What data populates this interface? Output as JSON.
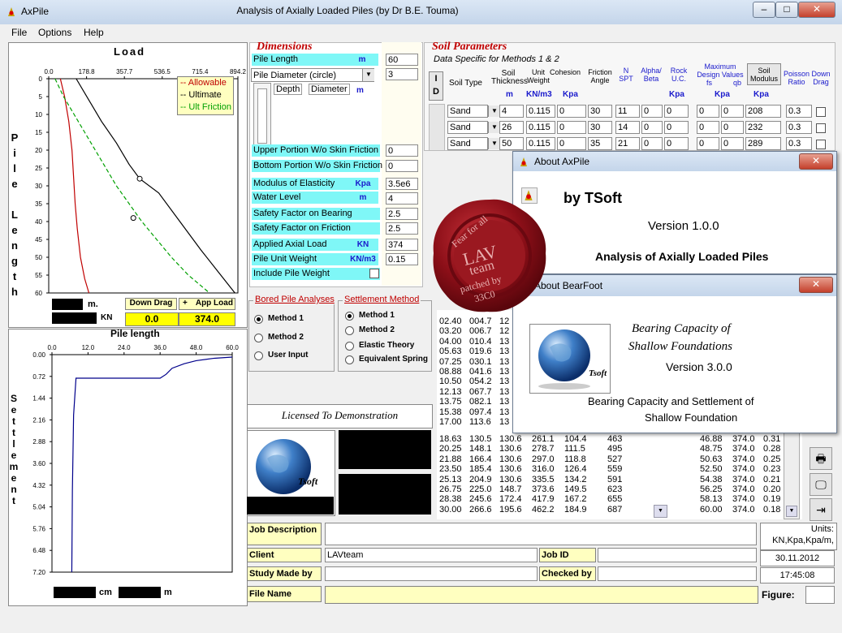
{
  "window": {
    "app_name": "AxPile",
    "title": "Analysis of Axially Loaded Piles (by Dr B.E. Touma)",
    "min": "–",
    "max": "□",
    "close": "✕"
  },
  "menu": [
    "File",
    "Options",
    "Help"
  ],
  "load_chart": {
    "title": "Load",
    "y_label": "Pile Length",
    "x_ticks": [
      "0.0",
      "178.8",
      "357.7",
      "536.5",
      "715.4",
      "894.2"
    ],
    "y_ticks": [
      "0",
      "5",
      "10",
      "15",
      "20",
      "25",
      "30",
      "35",
      "40",
      "45",
      "50",
      "55",
      "60"
    ],
    "legend": [
      "Allowable",
      "Ultimate",
      "Ult Friction"
    ],
    "unit_m": "m.",
    "unit_kn": "KN",
    "down_drag_label": "Down Drag",
    "app_load_label": "App Load",
    "plus": "+",
    "down_drag_value": "0.0",
    "app_load_value": "374.0"
  },
  "chart_data": [
    {
      "type": "line",
      "title": "Load",
      "ylabel": "Pile Length",
      "xlim": [
        0,
        894.2
      ],
      "ylim": [
        0,
        60
      ],
      "series": [
        {
          "name": "Allowable",
          "color": "#c00000",
          "points": [
            [
              55,
              0
            ],
            [
              75,
              5
            ],
            [
              95,
              12
            ],
            [
              110,
              20
            ],
            [
              118,
              28
            ],
            [
              125,
              35
            ],
            [
              135,
              42
            ],
            [
              150,
              50
            ],
            [
              170,
              56
            ],
            [
              190,
              60
            ]
          ]
        },
        {
          "name": "Ultimate",
          "color": "#000000",
          "points": [
            [
              130,
              0
            ],
            [
              190,
              6
            ],
            [
              250,
              12
            ],
            [
              320,
              18
            ],
            [
              380,
              24
            ],
            [
              430,
              28
            ],
            [
              520,
              32
            ],
            [
              620,
              40
            ],
            [
              720,
              48
            ],
            [
              800,
              54
            ],
            [
              880,
              60
            ]
          ]
        },
        {
          "name": "Ult Friction",
          "color": "#00a000",
          "points": [
            [
              30,
              0
            ],
            [
              70,
              5
            ],
            [
              120,
              10
            ],
            [
              170,
              15
            ],
            [
              220,
              20
            ],
            [
              270,
              25
            ],
            [
              320,
              30
            ],
            [
              380,
              35
            ],
            [
              440,
              40
            ],
            [
              510,
              45
            ],
            [
              580,
              50
            ],
            [
              660,
              55
            ],
            [
              760,
              60
            ]
          ]
        }
      ],
      "markers": [
        [
          430,
          28
        ],
        [
          400,
          39
        ]
      ]
    },
    {
      "type": "line",
      "title": "Pile length",
      "ylabel": "Settlement",
      "xlim": [
        0,
        60
      ],
      "ylim": [
        0,
        7.2
      ],
      "series": [
        {
          "name": "",
          "color": "#00008b",
          "points": [
            [
              6.6,
              7.2
            ],
            [
              6.8,
              4.5
            ],
            [
              7.2,
              2.0
            ],
            [
              8.0,
              0.78
            ],
            [
              12,
              0.78
            ],
            [
              24,
              0.78
            ],
            [
              36,
              0.78
            ],
            [
              38,
              0.65
            ],
            [
              40,
              0.45
            ],
            [
              44,
              0.3
            ],
            [
              48,
              0.2
            ],
            [
              54,
              0.12
            ],
            [
              60,
              0.08
            ]
          ]
        }
      ]
    }
  ],
  "settlement_chart": {
    "title": "Pile length",
    "y_label": "Settlement",
    "x_ticks": [
      "0.0",
      "12.0",
      "24.0",
      "36.0",
      "48.0",
      "60.0"
    ],
    "y_ticks": [
      "0.00",
      "0.72",
      "1.44",
      "2.16",
      "2.88",
      "3.60",
      "4.32",
      "5.04",
      "5.76",
      "6.48",
      "7.20"
    ],
    "unit_cm": "cm",
    "unit_m": "m"
  },
  "dimensions": {
    "title": "Dimensions",
    "pile_length": {
      "label": "Pile Length",
      "unit": "m",
      "value": "60"
    },
    "pile_diameter": {
      "label": "Pile Diameter (circle)",
      "value": "3"
    },
    "depth_col": "Depth",
    "diameter_col": "Diameter",
    "diameter_unit": "m",
    "upper_portion": {
      "label": "Upper Portion W/o Skin Friction",
      "value": "0"
    },
    "bottom_portion": {
      "label": "Bottom Portion W/o Skin Friction",
      "value": "0"
    },
    "modulus": {
      "label": "Modulus of Elasticity",
      "unit": "Kpa",
      "value": "3.5e6"
    },
    "water_level": {
      "label": "Water Level",
      "unit": "m",
      "value": "4"
    },
    "sf_bearing": {
      "label": "Safety Factor on Bearing",
      "value": "2.5"
    },
    "sf_friction": {
      "label": "Safety Factor on Friction",
      "value": "2.5"
    },
    "axial_load": {
      "label": "Applied Axial Load",
      "unit": "KN",
      "value": "374"
    },
    "unit_weight": {
      "label": "Pile Unit Weight",
      "unit": "KN/m3",
      "value": "0.15"
    },
    "include_weight": {
      "label": "Include Pile Weight"
    }
  },
  "bored": {
    "title": "Bored Pile Analyses",
    "options": [
      "Method 1",
      "Method 2",
      "User Input"
    ],
    "selected": 0
  },
  "settlement_method": {
    "title": "Settlement Method",
    "options": [
      "Method 1",
      "Method 2",
      "Elastic Theory",
      "Equivalent Spring"
    ],
    "selected": 0
  },
  "license": "Licensed To Demonstration",
  "logo_text": "Tsoft",
  "soil": {
    "title": "Soil Parameters",
    "subtitle": "Data Specific for Methods 1 & 2",
    "id_btn": [
      "I",
      "D"
    ],
    "headers": {
      "soil_type": "Soil Type",
      "soil_thickness": "Soil Thickness",
      "unit_weight": "Unit Weight",
      "cohesion": "Cohesion",
      "friction_angle": "Friction Angle",
      "n_spt": "N SPT",
      "alpha_beta": "Alpha/ Beta",
      "rock_uc": "Rock U.C.",
      "max_design": "Maximum Design Values",
      "fs": "fs",
      "qb": "qb",
      "soil_modulus": "Soil Modulus",
      "poisson": "Poisson Ratio",
      "down_drag": "Down Drag"
    },
    "units": {
      "m": "m",
      "knm3": "KN/m3",
      "kpa1": "Kpa",
      "kpa2": "Kpa",
      "kpa3": "Kpa",
      "kpa4": "Kpa"
    },
    "rows": [
      [
        "Sand",
        "4",
        "0.115",
        "0",
        "30",
        "11",
        "0",
        "0",
        "0",
        "0",
        "208",
        "0.3"
      ],
      [
        "Sand",
        "26",
        "0.115",
        "0",
        "30",
        "14",
        "0",
        "0",
        "0",
        "0",
        "232",
        "0.3"
      ],
      [
        "Sand",
        "50",
        "0.115",
        "0",
        "35",
        "21",
        "0",
        "0",
        "0",
        "0",
        "289",
        "0.3"
      ]
    ]
  },
  "results_left": [
    [
      "02.40",
      "004.7",
      "12"
    ],
    [
      "03.20",
      "006.7",
      "12"
    ],
    [
      "04.00",
      "010.4",
      "13"
    ],
    [
      "05.63",
      "019.6",
      "13"
    ],
    [
      "07.25",
      "030.1",
      "13"
    ],
    [
      "08.88",
      "041.6",
      "13"
    ],
    [
      "10.50",
      "054.2",
      "13"
    ],
    [
      "12.13",
      "067.7",
      "13"
    ],
    [
      "13.75",
      "082.1",
      "13"
    ],
    [
      "15.38",
      "097.4",
      "13"
    ],
    [
      "17.00",
      "113.6",
      "13"
    ]
  ],
  "results_full": [
    [
      "18.63",
      "130.5",
      "130.6",
      "261.1",
      "104.4",
      "463",
      "46.88",
      "374.0",
      "0.31"
    ],
    [
      "20.25",
      "148.1",
      "130.6",
      "278.7",
      "111.5",
      "495",
      "48.75",
      "374.0",
      "0.28"
    ],
    [
      "21.88",
      "166.4",
      "130.6",
      "297.0",
      "118.8",
      "527",
      "50.63",
      "374.0",
      "0.25"
    ],
    [
      "23.50",
      "185.4",
      "130.6",
      "316.0",
      "126.4",
      "559",
      "52.50",
      "374.0",
      "0.23"
    ],
    [
      "25.13",
      "204.9",
      "130.6",
      "335.5",
      "134.2",
      "591",
      "54.38",
      "374.0",
      "0.21"
    ],
    [
      "26.75",
      "225.0",
      "148.7",
      "373.6",
      "149.5",
      "623",
      "56.25",
      "374.0",
      "0.20"
    ],
    [
      "28.38",
      "245.6",
      "172.4",
      "417.9",
      "167.2",
      "655",
      "58.13",
      "374.0",
      "0.19"
    ],
    [
      "30.00",
      "266.6",
      "195.6",
      "462.2",
      "184.9",
      "687",
      "60.00",
      "374.0",
      "0.18"
    ]
  ],
  "job": {
    "description_label": "Job Description",
    "client_label": "Client",
    "client_value": "LAVteam",
    "job_id_label": "Job ID",
    "study_label": "Study Made by",
    "checked_label": "Checked by",
    "file_label": "File Name",
    "figure_label": "Figure:",
    "units_text": "Units:",
    "units_value": "KN,Kpa,Kpa/m,",
    "date": "30.11.2012",
    "time": "17:45:08"
  },
  "about_axpile": {
    "title": "About AxPile",
    "by": "by TSoft",
    "version": "Version 1.0.0",
    "desc": "Analysis of Axially Loaded Piles"
  },
  "about_bearfoot": {
    "title": "About BearFoot",
    "line1": "Bearing Capacity of",
    "line2": "Shallow Foundations",
    "version": "Version 3.0.0",
    "desc1": "Bearing Capacity and Settlement of",
    "desc2": "Shallow Foundation",
    "close": "✕"
  },
  "seal": {
    "line1": "LAV",
    "line2": "team",
    "line3": "patched by",
    "line4": "33C0",
    "arc": "Fear for all"
  },
  "colors": {
    "cyan": "#7ff7f7",
    "red_title": "#c00000",
    "yellow": "#ffffc0",
    "blue_unit": "#1a1acc"
  }
}
